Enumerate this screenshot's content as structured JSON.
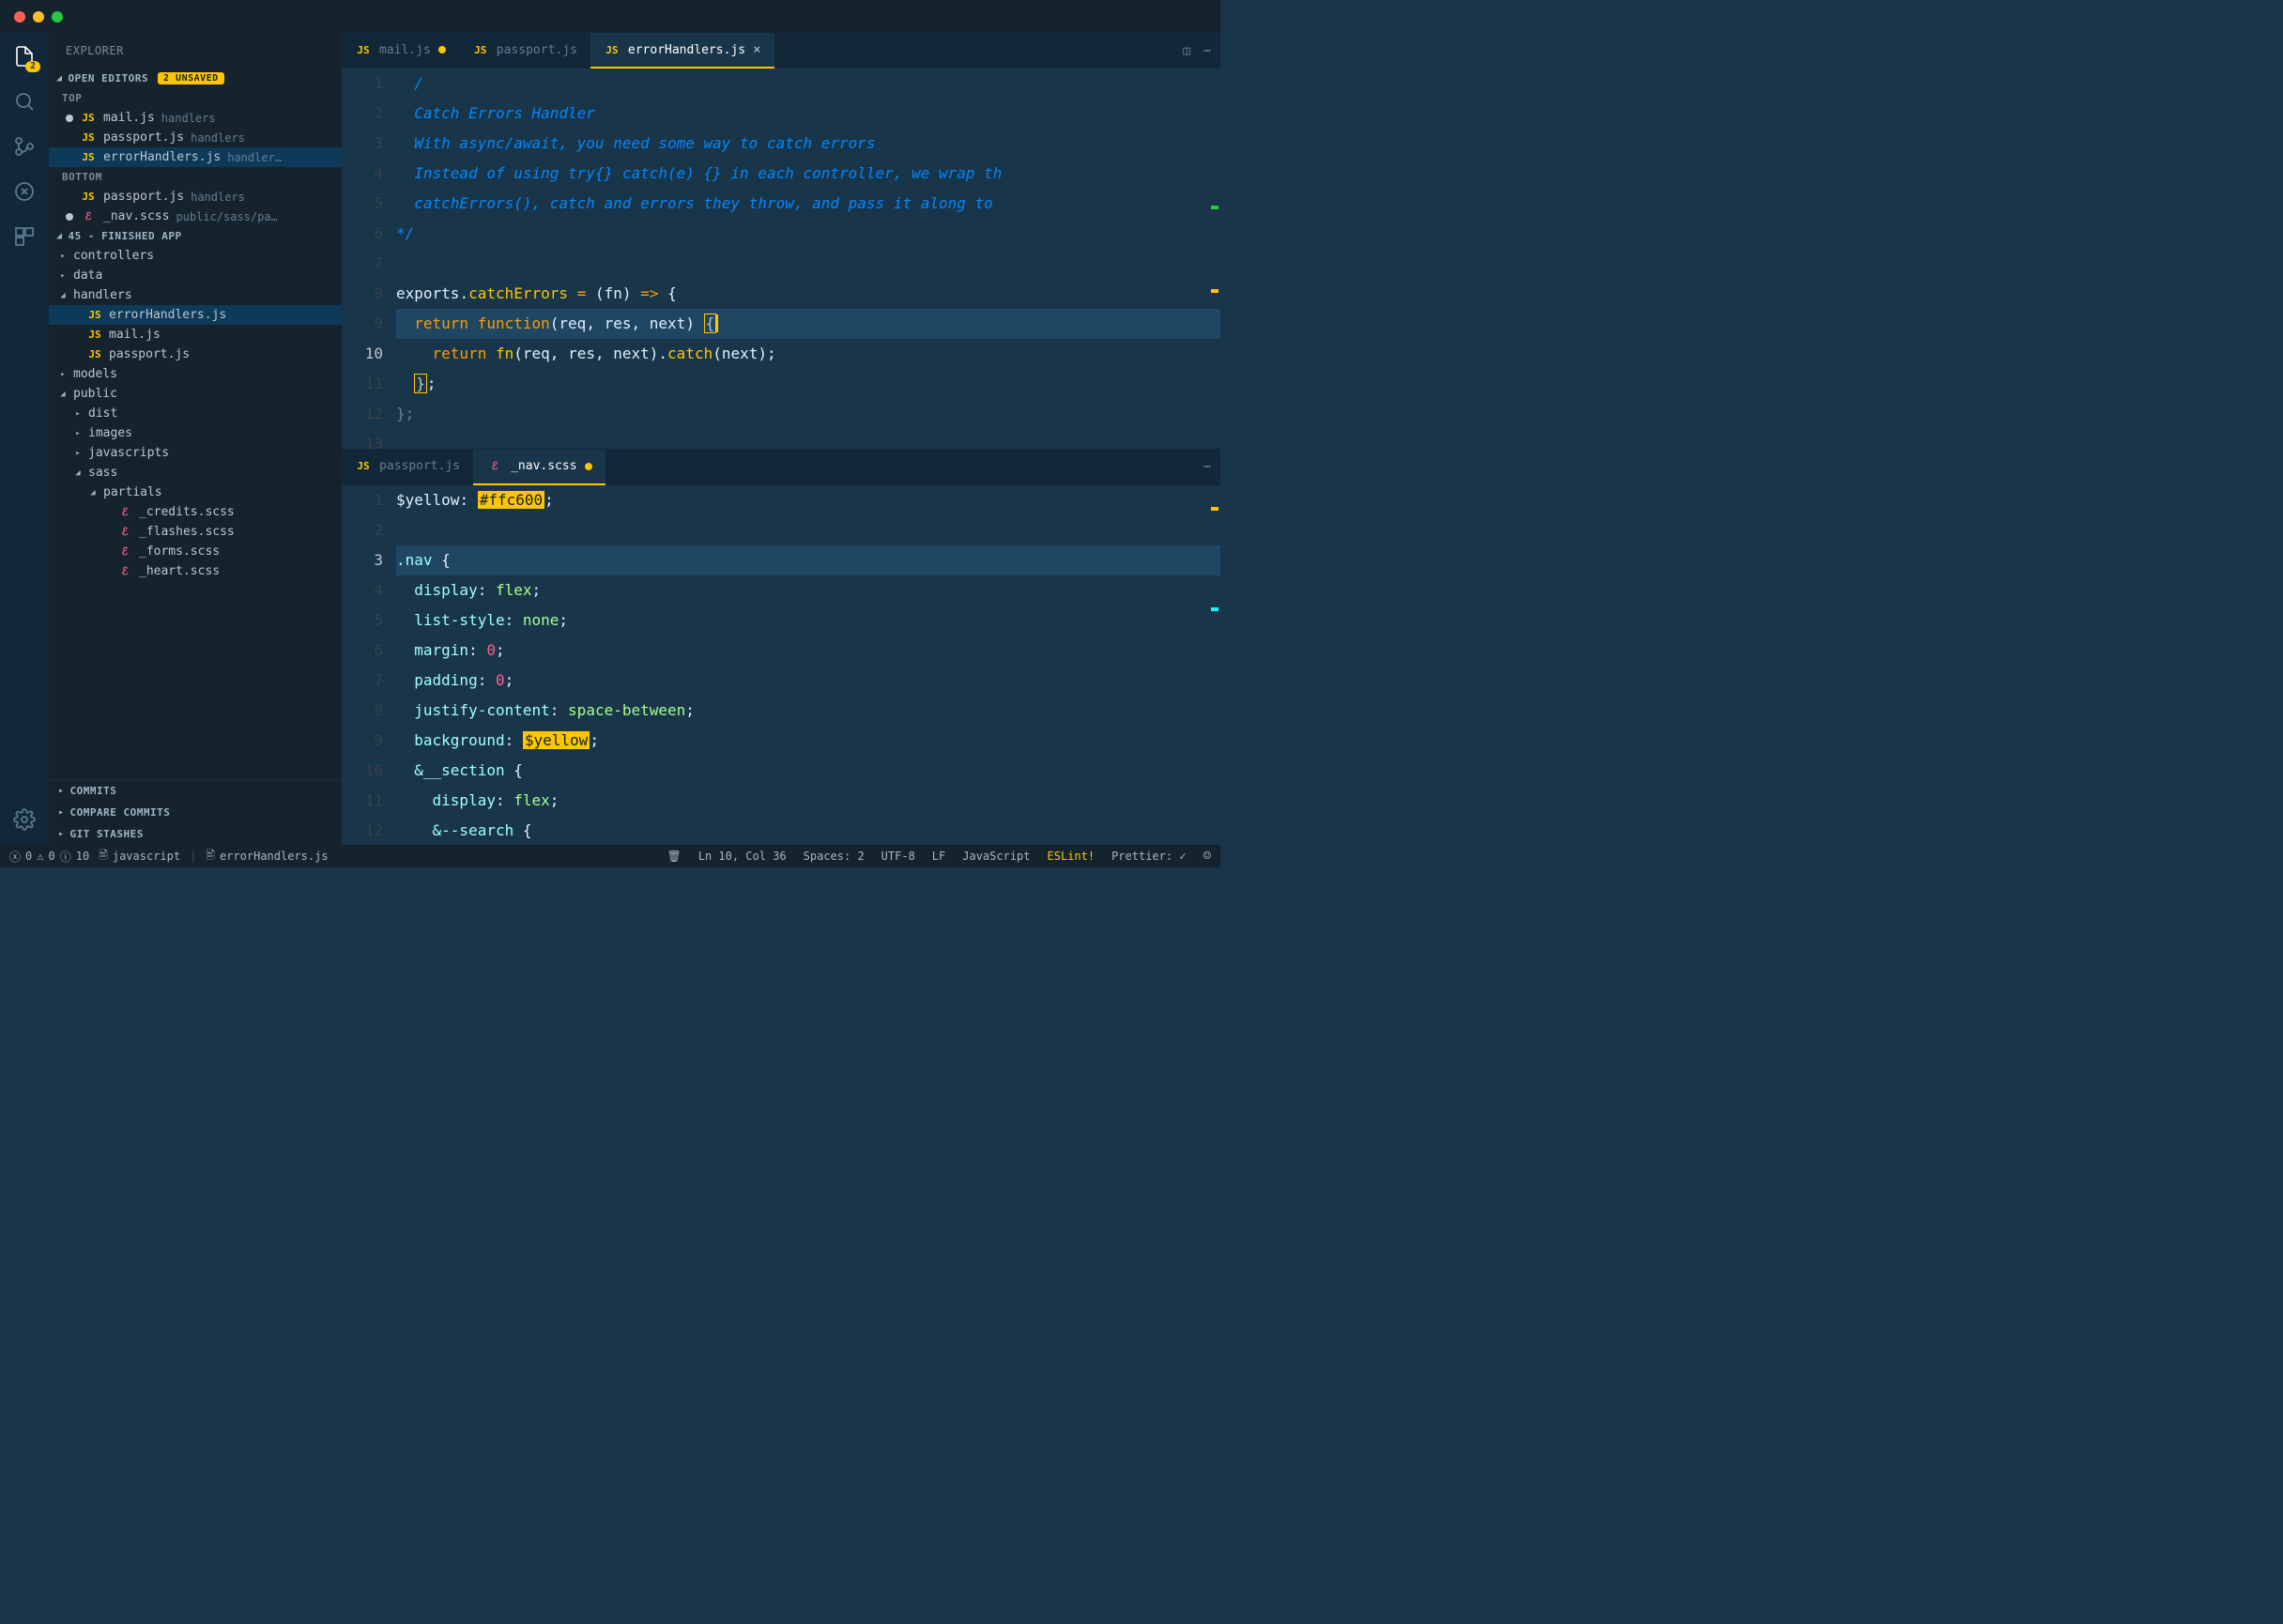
{
  "activity_badge": "2",
  "sidebar": {
    "title": "EXPLORER",
    "open_editors_label": "OPEN EDITORS",
    "unsaved_badge": "2 UNSAVED",
    "group_top": "TOP",
    "group_bottom": "BOTTOM",
    "oe_top": [
      {
        "name": "mail.js",
        "path": "handlers",
        "icon": "JS",
        "dirty": true
      },
      {
        "name": "passport.js",
        "path": "handlers",
        "icon": "JS",
        "dirty": false
      },
      {
        "name": "errorHandlers.js",
        "path": "handler…",
        "icon": "JS",
        "dirty": false,
        "active": true
      }
    ],
    "oe_bottom": [
      {
        "name": "passport.js",
        "path": "handlers",
        "icon": "JS",
        "dirty": false
      },
      {
        "name": "_nav.scss",
        "path": "public/sass/pa…",
        "icon": "SCSS",
        "dirty": true
      }
    ],
    "project_name": "45 - FINISHED APP",
    "tree": [
      {
        "type": "folder",
        "name": "controllers",
        "depth": 0,
        "open": false
      },
      {
        "type": "folder",
        "name": "data",
        "depth": 0,
        "open": false
      },
      {
        "type": "folder",
        "name": "handlers",
        "depth": 0,
        "open": true
      },
      {
        "type": "file",
        "name": "errorHandlers.js",
        "depth": 1,
        "icon": "JS",
        "active": true
      },
      {
        "type": "file",
        "name": "mail.js",
        "depth": 1,
        "icon": "JS"
      },
      {
        "type": "file",
        "name": "passport.js",
        "depth": 1,
        "icon": "JS"
      },
      {
        "type": "folder",
        "name": "models",
        "depth": 0,
        "open": false
      },
      {
        "type": "folder",
        "name": "public",
        "depth": 0,
        "open": true
      },
      {
        "type": "folder",
        "name": "dist",
        "depth": 1,
        "open": false
      },
      {
        "type": "folder",
        "name": "images",
        "depth": 1,
        "open": false
      },
      {
        "type": "folder",
        "name": "javascripts",
        "depth": 1,
        "open": false
      },
      {
        "type": "folder",
        "name": "sass",
        "depth": 1,
        "open": true
      },
      {
        "type": "folder",
        "name": "partials",
        "depth": 2,
        "open": true
      },
      {
        "type": "file",
        "name": "_credits.scss",
        "depth": 3,
        "icon": "SCSS"
      },
      {
        "type": "file",
        "name": "_flashes.scss",
        "depth": 3,
        "icon": "SCSS"
      },
      {
        "type": "file",
        "name": "_forms.scss",
        "depth": 3,
        "icon": "SCSS"
      },
      {
        "type": "file",
        "name": "_heart.scss",
        "depth": 3,
        "icon": "SCSS"
      }
    ],
    "bottom_sections": [
      "COMMITS",
      "COMPARE COMMITS",
      "GIT STASHES"
    ]
  },
  "editor_top": {
    "tabs": [
      {
        "label": "mail.js",
        "icon": "JS",
        "dirty": true
      },
      {
        "label": "passport.js",
        "icon": "JS"
      },
      {
        "label": "errorHandlers.js",
        "icon": "JS",
        "active": true,
        "close": true
      }
    ],
    "start_line": 1,
    "highlight_line": 10,
    "code": [
      {
        "t": "comment",
        "s": "  /"
      },
      {
        "t": "comment",
        "s": "  Catch Errors Handler"
      },
      {
        "t": "comment",
        "s": ""
      },
      {
        "t": "comment",
        "s": "  With async/await, you need some way to catch errors"
      },
      {
        "t": "comment",
        "s": "  Instead of using try{} catch(e) {} in each controller, we wrap th"
      },
      {
        "t": "comment",
        "s": "  catchErrors(), catch and errors they throw, and pass it along to "
      },
      {
        "t": "comment",
        "s": "*/"
      },
      {
        "t": "blank",
        "s": ""
      },
      {
        "t": "js1"
      },
      {
        "t": "js2",
        "hl": true
      },
      {
        "t": "js3"
      },
      {
        "t": "js4"
      },
      {
        "t": "js5"
      }
    ]
  },
  "editor_bot": {
    "tabs": [
      {
        "label": "passport.js",
        "icon": "JS"
      },
      {
        "label": "_nav.scss",
        "icon": "SCSS",
        "active": true,
        "dirty": true
      }
    ],
    "start_line": 1,
    "highlight_line": 3,
    "code": [
      {
        "t": "scss1"
      },
      {
        "t": "blank",
        "s": ""
      },
      {
        "t": "scss_nav",
        "hl": true
      },
      {
        "t": "prop",
        "p": "display",
        "v": "flex"
      },
      {
        "t": "prop",
        "p": "list-style",
        "v": "none"
      },
      {
        "t": "propn",
        "p": "margin",
        "v": "0"
      },
      {
        "t": "propn",
        "p": "padding",
        "v": "0"
      },
      {
        "t": "prop",
        "p": "justify-content",
        "v": "space-between"
      },
      {
        "t": "propvar",
        "p": "background",
        "v": "$yellow"
      },
      {
        "t": "nest1"
      },
      {
        "t": "prop2",
        "p": "display",
        "v": "flex"
      },
      {
        "t": "nest2"
      }
    ]
  },
  "status": {
    "errors": "0",
    "warnings": "0",
    "info": "10",
    "lang_item": "javascript",
    "file_item": "errorHandlers.js",
    "cursor": "Ln 10, Col 36",
    "spaces": "Spaces: 2",
    "encoding": "UTF-8",
    "eol": "LF",
    "language": "JavaScript",
    "eslint": "ESLint!",
    "prettier": "Prettier: ✓"
  }
}
